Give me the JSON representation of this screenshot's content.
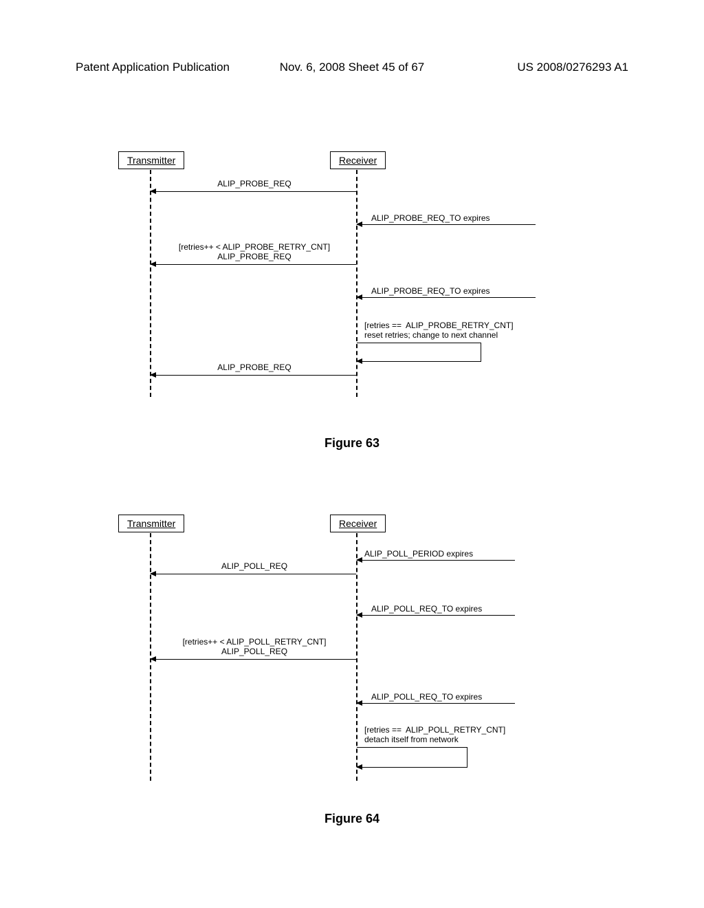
{
  "header": {
    "left": "Patent Application Publication",
    "center": "Nov. 6, 2008  Sheet 45 of 67",
    "right": "US 2008/0276293 A1"
  },
  "fig63": {
    "transmitter": "Transmitter",
    "receiver": "Receiver",
    "msg1": "ALIP_PROBE_REQ",
    "side1": "ALIP_PROBE_REQ_TO expires",
    "msg2": "[retries++ < ALIP_PROBE_RETRY_CNT]\nALIP_PROBE_REQ",
    "side2": "ALIP_PROBE_REQ_TO expires",
    "self": "[retries ==  ALIP_PROBE_RETRY_CNT]\nreset retries; change to next channel",
    "msg3": "ALIP_PROBE_REQ",
    "caption": "Figure 63"
  },
  "fig64": {
    "transmitter": "Transmitter",
    "receiver": "Receiver",
    "side0": "ALIP_POLL_PERIOD expires",
    "msg1": "ALIP_POLL_REQ",
    "side1": "ALIP_POLL_REQ_TO expires",
    "msg2": "[retries++ < ALIP_POLL_RETRY_CNT]\nALIP_POLL_REQ",
    "side2": "ALIP_POLL_REQ_TO expires",
    "self": "[retries ==  ALIP_POLL_RETRY_CNT]\ndetach itself from network",
    "caption": "Figure 64"
  }
}
